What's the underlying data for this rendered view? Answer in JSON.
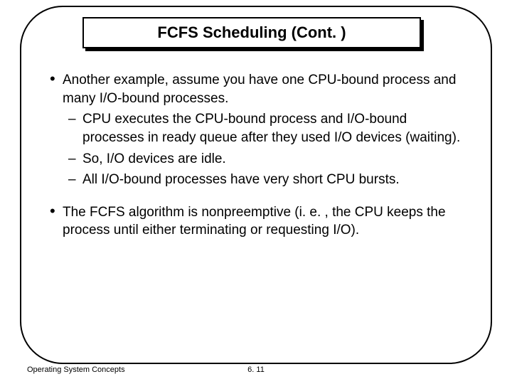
{
  "title": "FCFS Scheduling (Cont. )",
  "bullets": [
    {
      "text": "Another example, assume you have one CPU-bound process and many I/O-bound processes.",
      "subs": [
        "CPU executes the CPU-bound process and I/O-bound processes in ready queue after they used I/O devices (waiting).",
        "So, I/O devices are idle.",
        "All I/O-bound processes have very short CPU bursts."
      ]
    },
    {
      "text": "The FCFS algorithm is nonpreemptive (i. e. , the CPU keeps the process until either terminating or requesting I/O).",
      "subs": []
    }
  ],
  "footer_left": "Operating System Concepts",
  "footer_center": "6. 11"
}
